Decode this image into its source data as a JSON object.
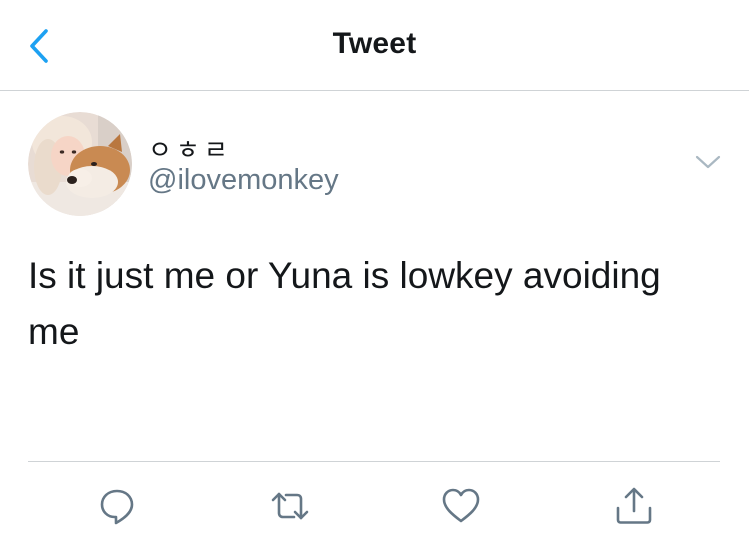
{
  "header": {
    "title": "Tweet",
    "back_icon": "chevron-left-icon"
  },
  "tweet": {
    "author": {
      "display_name": "ㅇㅎㄹ",
      "handle": "@ilovemonkey",
      "avatar_icon": "avatar-photo"
    },
    "text": "Is it just me or Yuna is lowkey avoiding me",
    "more_icon": "chevron-down-icon"
  },
  "actions": {
    "reply_icon": "reply-icon",
    "retweet_icon": "retweet-icon",
    "like_icon": "heart-icon",
    "share_icon": "share-icon"
  },
  "colors": {
    "accent": "#1da1f2",
    "text_primary": "#14171a",
    "text_secondary": "#657786",
    "icon_gray": "#657786",
    "divider": "#cfd3d6"
  }
}
